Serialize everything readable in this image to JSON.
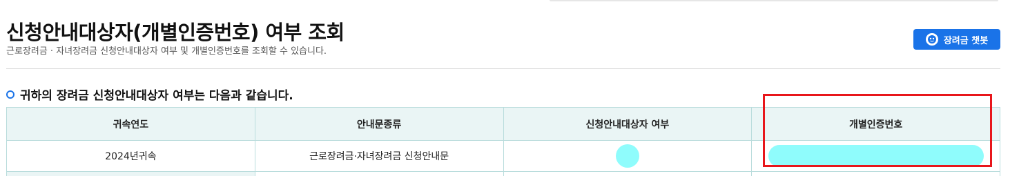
{
  "header": {
    "title": "신청안내대상자(개별인증번호) 여부 조회",
    "description": "근로장려금 · 자녀장려금 신청안내대상자 여부 및 개별인증번호를 조회할 수 있습니다.",
    "chatbot_button_label": "장려금 챗봇"
  },
  "section": {
    "title": "귀하의 장려금 신청안내대상자 여부는 다음과 같습니다."
  },
  "table": {
    "columns": [
      "귀속연도",
      "안내문종류",
      "신청안내대상자 여부",
      "개별인증번호"
    ],
    "rows": [
      {
        "year": "2024년귀속",
        "notice_type": "근로장려금·자녀장려금 신청안내문"
      }
    ]
  },
  "colors": {
    "accent": "#1a73e8",
    "table_header_bg": "#eaf5f5",
    "table_border": "#b9dcdc",
    "redaction": "#8ffcfc",
    "highlight": "#e8161b"
  },
  "icons": {
    "chatbot": "chatbot-face-icon",
    "section_bullet": "circle-bullet-icon"
  }
}
